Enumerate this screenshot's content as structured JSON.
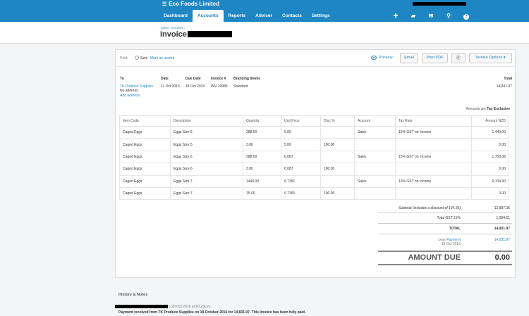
{
  "app": {
    "org_name": "Eco Foods Limited",
    "nav_tabs": [
      {
        "label": "Dashboard"
      },
      {
        "label": "Accounts"
      },
      {
        "label": "Reports"
      },
      {
        "label": "Adviser"
      },
      {
        "label": "Contacts"
      },
      {
        "label": "Settings"
      }
    ],
    "active_tab": "Accounts",
    "top_icons": [
      "plus-icon",
      "folder-icon",
      "mail-icon",
      "search-icon",
      "help-icon"
    ]
  },
  "breadcrumb": "Sales › Invoices ›",
  "page_title": "Invoice",
  "toolbar": {
    "paid_label": "Paid",
    "sent_label": "Sent",
    "mark_unsent": "Mark as unsent",
    "preview": "Preview",
    "email": "Email",
    "print_pdf": "Print PDF",
    "invoice_options": "Invoice Options"
  },
  "meta": {
    "to_label": "To",
    "to_name": "TK Produce Supplies",
    "no_address": "No address",
    "add_address": "Add address",
    "date_label": "Date",
    "date": "11 Oct 2016",
    "due_label": "Due Date",
    "due_date": "18 Oct 2016",
    "invoice_no_label": "Invoice #",
    "invoice_no": "INV-19986",
    "branding_label": "Branding theme",
    "branding": "Standard",
    "total_label": "Total",
    "total": "14,831.97"
  },
  "amounts_are_label": "Amounts are",
  "amounts_are_value": "Tax Exclusive",
  "table": {
    "headers": [
      "Item Code",
      "Description",
      "Quantity",
      "Unit Price",
      "Disc %",
      "Account",
      "Tax Rate",
      "Amount NZD"
    ],
    "rows": [
      [
        "Caged Eggs",
        "Eggs Size 5",
        "288.00",
        "5.00",
        "",
        "Sales",
        "15% GST on Income",
        "1,440.00"
      ],
      [
        "Caged Eggs",
        "Eggs Size 5",
        "3.00",
        "5.00",
        "100.00",
        "",
        "",
        "0.00"
      ],
      [
        "Caged Eggs",
        "Eggs Size 6",
        "288.00",
        "6.087",
        "",
        "Sales",
        "15% GST on Income",
        "1,753.06"
      ],
      [
        "Caged Eggs",
        "Eggs Size 6",
        "3.00",
        "6.087",
        "100.00",
        "",
        "",
        "0.00"
      ],
      [
        "Caged Eggs",
        "Eggs Size 7",
        "1440.00",
        "6.7391",
        "",
        "Sales",
        "15% GST on Income",
        "9,704.30"
      ],
      [
        "Caged Eggs",
        "Eggs Size 7",
        "15.00",
        "6.7391",
        "100.00",
        "",
        "",
        "0.00"
      ]
    ]
  },
  "totals": {
    "subtotal_label": "Subtotal",
    "subtotal_note": "(includes a discount of 134.35)",
    "subtotal": "12,897.36",
    "gst_label": "Total GST  15%",
    "gst": "1,934.61",
    "total_label": "TOTAL",
    "total": "14,831.97",
    "less_label": "Less",
    "payment_link": "Payment",
    "payment_date": "18 Oct 2016",
    "payment": "14,831.97",
    "amount_due_label": "AMOUNT DUE",
    "amount_due": "0.00"
  },
  "history": {
    "title": "History & Notes",
    "entry_time": "» 20 Oct 2016 at 10:29p.m.",
    "entry_message": "Payment received from TK Produce Supplies on 18 October 2016 for 14,831.97. This invoice has been fully paid."
  }
}
